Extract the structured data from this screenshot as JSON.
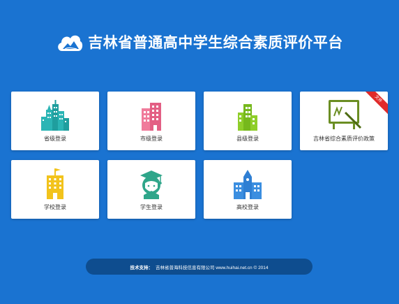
{
  "header": {
    "title": "吉林省普通高中学生综合素质评价平台",
    "logo_icon": "cloud-mountain-logo"
  },
  "cards": [
    {
      "label": "省级登录",
      "icon": "city-skyline-icon",
      "color": "#2bb5b5"
    },
    {
      "label": "市级登录",
      "icon": "office-building-icon",
      "color": "#f07b9b"
    },
    {
      "label": "县级登录",
      "icon": "building-cluster-icon",
      "color": "#8fce2a"
    },
    {
      "label": "吉林省综合素质评价政策",
      "icon": "chalkboard-icon",
      "color": "#6b8e23",
      "ribbon": "文件"
    },
    {
      "label": "学校登录",
      "icon": "school-building-icon",
      "color": "#f2c31c"
    },
    {
      "label": "学生登录",
      "icon": "graduate-student-icon",
      "color": "#2fa68a"
    },
    {
      "label": "高校登录",
      "icon": "university-building-icon",
      "color": "#2f7fd3"
    }
  ],
  "footer": {
    "label": "技术支持：",
    "text": "吉林省普海科技信息有限公司 www.huihai.net.cn © 2014"
  },
  "colors": {
    "background": "#1a73d1",
    "footer_bar": "#0e4d8f",
    "ribbon": "#e02a2a"
  }
}
